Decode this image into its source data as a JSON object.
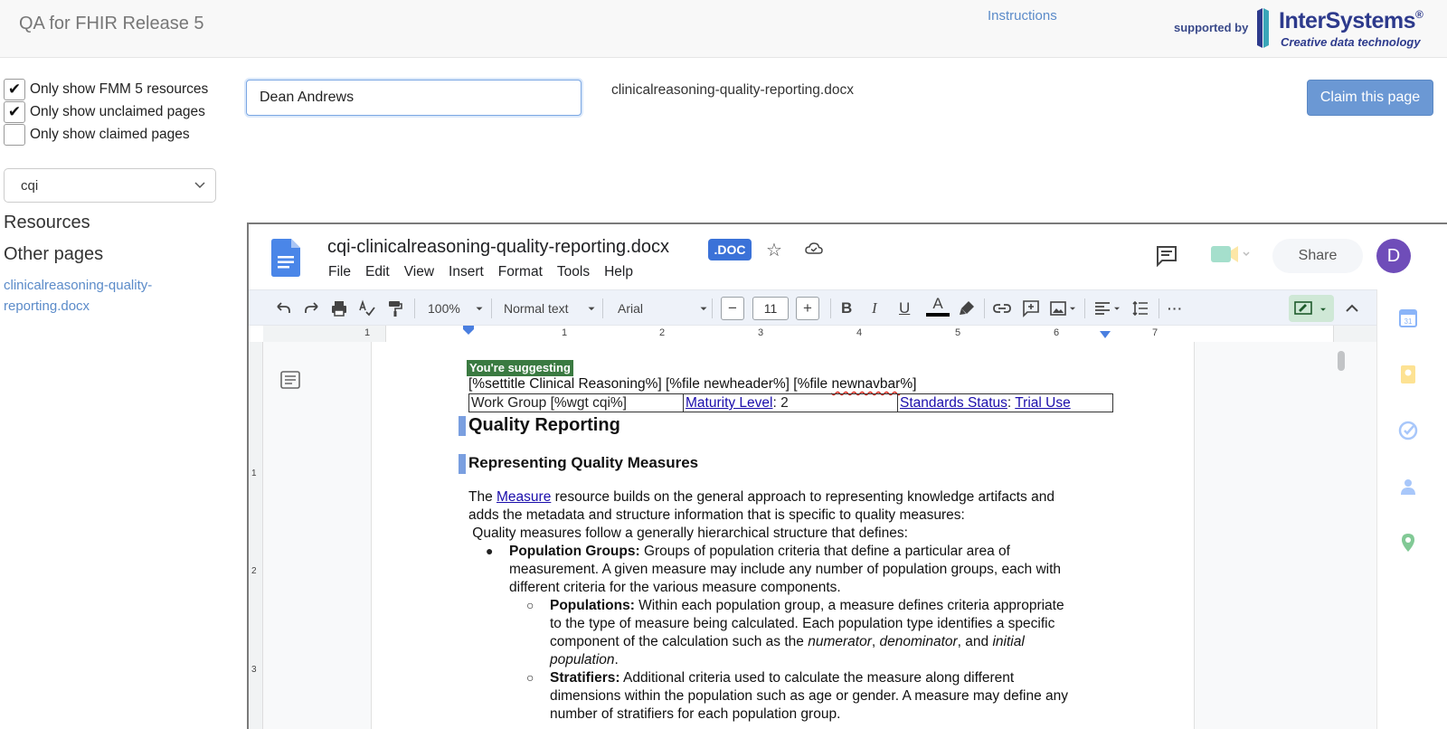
{
  "header": {
    "title": "QA for FHIR Release 5",
    "instructions_link": "Instructions",
    "supported_by": "supported by",
    "logo_name": "InterSystems",
    "logo_reg": "®",
    "logo_tagline": "Creative data technology"
  },
  "filters": [
    {
      "label": "Only show FMM 5 resources",
      "checked": true
    },
    {
      "label": "Only show unclaimed pages",
      "checked": true
    },
    {
      "label": "Only show claimed pages",
      "checked": false
    }
  ],
  "workgroup_select": {
    "value": "cqi"
  },
  "sidebar": {
    "resources_heading": "Resources",
    "other_pages_heading": "Other pages",
    "page_link": "clinicalreasoning-quality-reporting.docx"
  },
  "claim_form": {
    "name_value": "Dean Andrews",
    "selected_file": "clinicalreasoning-quality-reporting.docx",
    "claim_button": "Claim this page"
  },
  "colors": {
    "link": "#5b8bc9",
    "claim_button": "#6b98d4",
    "docs_blue": "#3b72d8",
    "avatar": "#6f4db9",
    "suggesting_badge": "#3a7a41"
  },
  "docs": {
    "title": "cqi-clinicalreasoning-quality-reporting.docx",
    "badge": ".DOC",
    "menu": [
      "File",
      "Edit",
      "View",
      "Insert",
      "Format",
      "Tools",
      "Help"
    ],
    "share_label": "Share",
    "avatar_initial": "D",
    "toolbar": {
      "zoom": "100%",
      "style": "Normal text",
      "font": "Arial",
      "font_size": "11",
      "minus": "−",
      "plus": "+",
      "bold": "B",
      "italic": "I",
      "underline": "U",
      "text_color": "A",
      "more": "···"
    },
    "ruler_numbers": [
      "1",
      "1",
      "2",
      "3",
      "4",
      "5",
      "6",
      "7"
    ],
    "vruler_numbers": [
      "1",
      "2",
      "3"
    ],
    "icons": [
      "undo-icon",
      "redo-icon",
      "print-icon",
      "spellcheck-icon",
      "paint-format-icon",
      "link-icon",
      "add-comment-icon",
      "image-icon",
      "align-icon",
      "line-spacing-icon",
      "suggesting-mode-icon",
      "collapse-icon",
      "calendar-icon",
      "keep-icon",
      "tasks-icon",
      "contacts-icon",
      "maps-icon"
    ]
  },
  "document": {
    "suggesting_badge": "You're suggesting",
    "line1_a": "[%settitle Clinical Reasoning%] [%file newheader%] [%file ",
    "line1_b": "newnavbar",
    "line1_c": "%]",
    "table": {
      "workgroup": "Work Group [%wgt cqi%]",
      "maturity_link": "Maturity Level",
      "maturity_value": ": 2",
      "status_link": "Standards Status",
      "status_sep": ": ",
      "status_value": "Trial Use"
    },
    "h1": "Quality Reporting",
    "h2": "Representing Quality Measures",
    "p1_a": "The ",
    "p1_link": "Measure",
    "p1_b": " resource builds on the general approach to representing knowledge artifacts and",
    "p1_line2": "adds the metadata and structure information that is specific to quality measures:",
    "p2": " Quality measures follow a generally hierarchical structure that defines:",
    "bullet1_bold": "Population Groups:",
    "bullet1_l1": " Groups of population criteria that define a particular area of",
    "bullet1_l2": "measurement. A given measure may include any number of population groups, each with",
    "bullet1_l3": "different criteria for the various measure components.",
    "sub1_bold": "Populations:",
    "sub1_l1": " Within each population group, a measure defines criteria appropriate",
    "sub1_l2": "to the type of measure being calculated. Each population type identifies a specific",
    "sub1_l3a": "component of the calculation such as the ",
    "sub1_num": "numerator",
    "sub1_c1": ", ",
    "sub1_den": "denominator",
    "sub1_c2": ", and ",
    "sub1_init": "initial",
    "sub1_l4a": "population",
    "sub1_l4b": ".",
    "sub2_bold": "Stratifiers:",
    "sub2_l1": " Additional criteria used to calculate the measure along different",
    "sub2_l2": "dimensions within the population such as age or gender. A measure may define any",
    "sub2_l3": "number of stratifiers for each population group."
  }
}
